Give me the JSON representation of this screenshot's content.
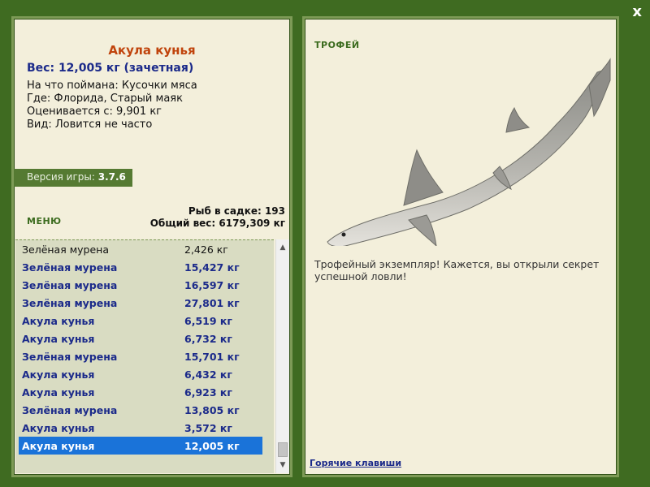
{
  "fish": {
    "title": "Акула кунья",
    "weight": "Вес: 12,005 кг (зачетная)",
    "bait": "На что поймана: Кусочки мяса",
    "location": "Где: Флорида, Старый маяк",
    "estimated": "Оценивается с: 9,901 кг",
    "rarity": "Вид: Ловится не часто"
  },
  "version": {
    "label": "Версия игры:",
    "value": "3.7.6"
  },
  "menu": {
    "label": "МЕНЮ"
  },
  "keepnet": {
    "count": "Рыб в садке: 193",
    "total": "Общий вес: 6179,309 кг"
  },
  "catch_list": [
    {
      "name": "Зелёная мурена",
      "weight": "2,426 кг",
      "style": "plain"
    },
    {
      "name": "Зелёная мурена",
      "weight": "15,427 кг",
      "style": "bold"
    },
    {
      "name": "Зелёная мурена",
      "weight": "16,597 кг",
      "style": "bold"
    },
    {
      "name": "Зелёная мурена",
      "weight": "27,801 кг",
      "style": "bold"
    },
    {
      "name": "Акула кунья",
      "weight": "6,519 кг",
      "style": "bold"
    },
    {
      "name": "Акула кунья",
      "weight": "6,732 кг",
      "style": "bold"
    },
    {
      "name": "Зелёная мурена",
      "weight": "15,701 кг",
      "style": "bold"
    },
    {
      "name": "Акула кунья",
      "weight": "6,432 кг",
      "style": "bold"
    },
    {
      "name": "Акула кунья",
      "weight": "6,923 кг",
      "style": "bold"
    },
    {
      "name": "Зелёная мурена",
      "weight": "13,805 кг",
      "style": "bold"
    },
    {
      "name": "Акула кунья",
      "weight": "3,572 кг",
      "style": "bold"
    },
    {
      "name": "Акула кунья",
      "weight": "12,005 кг",
      "style": "selected"
    }
  ],
  "trophy": {
    "label": "ТРОФЕЙ",
    "text": "Трофейный экземпляр! Кажется, вы открыли секрет успешной ловли!"
  },
  "hotkeys": {
    "label": "Горячие клавиши"
  },
  "close": {
    "label": "x"
  },
  "colors": {
    "background": "#3f6b21",
    "panel": "#f3efdb",
    "title": "#c0440c",
    "bold_text": "#1b2a8a",
    "selection": "#1a73d9"
  }
}
